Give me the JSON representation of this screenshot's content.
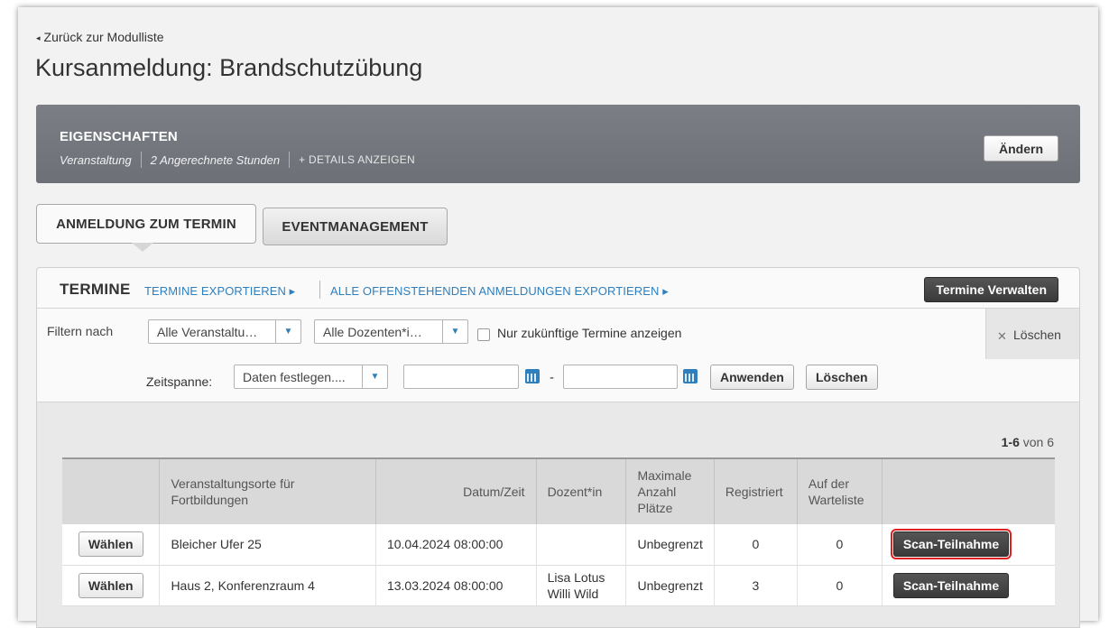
{
  "nav": {
    "back_label": "Zurück zur Modulliste"
  },
  "page": {
    "title": "Kursanmeldung: Brandschutzübung"
  },
  "properties": {
    "title": "EIGENSCHAFTEN",
    "type": "Veranstaltung",
    "hours": "2 Angerechnete Stunden",
    "details_link": "+ DETAILS ANZEIGEN",
    "edit_button": "Ändern"
  },
  "tabs": [
    {
      "label": "ANMELDUNG ZUM TERMIN",
      "active": true
    },
    {
      "label": "EVENTMANAGEMENT",
      "active": false
    }
  ],
  "termine": {
    "title": "TERMINE",
    "export_link": "TERMINE EXPORTIEREN ▸",
    "export_all_link": "ALLE OFFENSTEHENDEN ANMELDUNGEN EXPORTIEREN ▸",
    "manage_button": "Termine Verwalten"
  },
  "filters": {
    "label": "Filtern nach",
    "event_select": "Alle Veranstaltu…",
    "teacher_select": "Alle Dozenten*i…",
    "future_only_label": "Nur zukünftige Termine anzeigen",
    "future_only_checked": false,
    "clear_label": "Löschen",
    "timespan_label": "Zeitspanne:",
    "timespan_select": "Daten festlegen....",
    "date_from": "",
    "date_to": "",
    "date_separator": "-",
    "apply_button": "Anwenden",
    "reset_button": "Löschen"
  },
  "pagination": {
    "range": "1-6",
    "of_label": "von 6"
  },
  "table": {
    "headers": {
      "location": "Veranstaltungsorte für Fortbildungen",
      "datetime": "Datum/Zeit",
      "teacher": "Dozent*in",
      "max_places": "Maximale Anzahl Plätze",
      "registered": "Registriert",
      "waitlist": "Auf der Warteliste"
    },
    "rows": [
      {
        "select": "Wählen",
        "location": "Bleicher Ufer 25",
        "datetime": "10.04.2024 08:00:00",
        "teacher": "",
        "max_places": "Unbegrenzt",
        "registered": "0",
        "waitlist": "0",
        "action": "Scan-Teilnahme"
      },
      {
        "select": "Wählen",
        "location": "Haus 2, Konferenzraum 4",
        "datetime": "13.03.2024 08:00:00",
        "teacher": "Lisa Lotus\nWilli Wild",
        "max_places": "Unbegrenzt",
        "registered": "3",
        "waitlist": "0",
        "action": "Scan-Teilnahme"
      }
    ]
  },
  "colors": {
    "accent": "#2f7fbd",
    "banner": "#74777e",
    "highlight": "#e02020"
  }
}
